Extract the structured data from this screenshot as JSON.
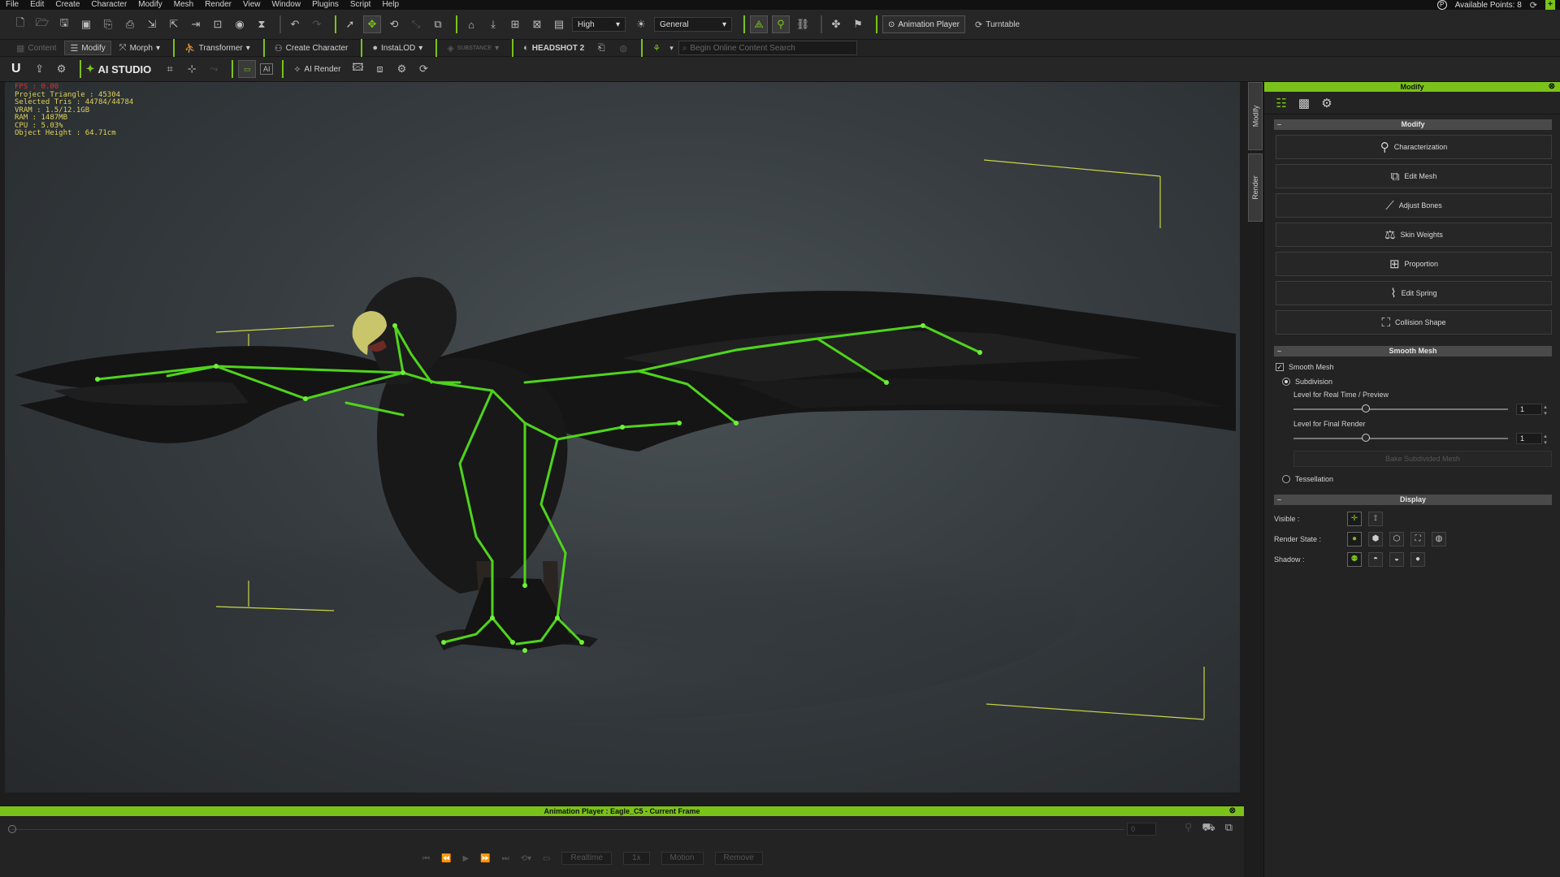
{
  "menu": [
    "File",
    "Edit",
    "Create",
    "Character",
    "Modify",
    "Mesh",
    "Render",
    "View",
    "Window",
    "Plugins",
    "Script",
    "Help"
  ],
  "account": {
    "points_icon": "P",
    "points_label": "Available Points: 8",
    "add_icon": "+"
  },
  "toolbar1": {
    "quality": "High",
    "preset": "General",
    "animation_player": "Animation Player",
    "turntable": "Turntable"
  },
  "toolbar2": {
    "content": "Content",
    "modify": "Modify",
    "morph": "Morph",
    "transformer": "Transformer",
    "create_character": "Create Character",
    "instalod": "InstaLOD",
    "substance": "SUBSTANCE",
    "headshot": "HEADSHOT 2",
    "search_placeholder": "Begin Online Content Search"
  },
  "toolbar3": {
    "logo": "U",
    "ai_studio": "AI STUDIO",
    "ai_render": "AI Render",
    "ai_label": "AI"
  },
  "stats": {
    "fps": "FPS : 0.00",
    "triangles": "Project Triangle : 45304",
    "selected": "Selected Tris : 44784/44784",
    "vram": "VRAM : 1.5/12.1GB",
    "ram": "RAM : 1487MB",
    "cpu": "CPU : 5.03%",
    "height": "Object Height : 64.71cm"
  },
  "side_tabs": [
    "Modify",
    "Render"
  ],
  "panel": {
    "title": "Modify",
    "modify_header": "Modify",
    "buttons": [
      "Characterization",
      "Edit Mesh",
      "Adjust Bones",
      "Skin Weights",
      "Proportion",
      "Edit Spring",
      "Collision Shape"
    ],
    "smooth_header": "Smooth Mesh",
    "smooth_mesh": "Smooth Mesh",
    "subdivision": "Subdivision",
    "level_realtime": "Level for Real Time / Preview",
    "level_realtime_value": "1",
    "level_final": "Level for Final Render",
    "level_final_value": "1",
    "bake": "Bake Subdivided Mesh",
    "tessellation": "Tessellation",
    "display_header": "Display",
    "visible": "Visible :",
    "render_state": "Render State :",
    "shadow": "Shadow :"
  },
  "anim_player": {
    "title": "Animation Player : Eagle_C5 - Current Frame",
    "frame": "0",
    "realtime": "Realtime",
    "speed": "1x",
    "motion": "Motion",
    "remove": "Remove"
  },
  "colors": {
    "accent": "#7ac21a",
    "bone": "#4fd41c",
    "stats": "#e0d25a",
    "fps": "#e03030"
  }
}
